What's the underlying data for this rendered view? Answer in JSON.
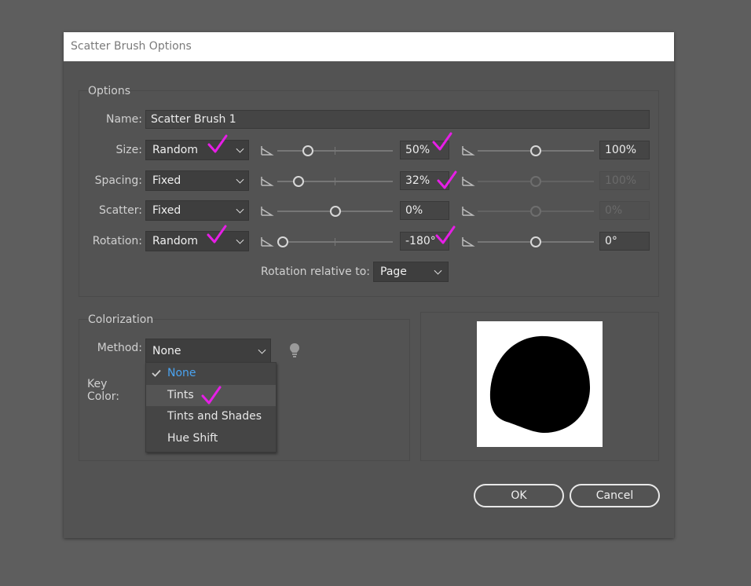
{
  "window": {
    "title": "Scatter Brush Options"
  },
  "options": {
    "group_label": "Options",
    "name_label": "Name:",
    "name_value": "Scatter Brush 1",
    "rows": [
      {
        "label": "Size:",
        "method": "Random",
        "min": "50%",
        "max": "100%",
        "max_enabled": true,
        "min_knob": 0.24,
        "max_knob": 0.5
      },
      {
        "label": "Spacing:",
        "method": "Fixed",
        "min": "32%",
        "max": "100%",
        "max_enabled": false,
        "min_knob": 0.15,
        "max_knob": 0.5
      },
      {
        "label": "Scatter:",
        "method": "Fixed",
        "min": "0%",
        "max": "0%",
        "max_enabled": false,
        "min_knob": 0.5,
        "max_knob": 0.5
      },
      {
        "label": "Rotation:",
        "method": "Random",
        "min": "-180°",
        "max": "0°",
        "max_enabled": true,
        "min_knob": 0.0,
        "max_knob": 0.5
      }
    ],
    "rotation_relative_label": "Rotation relative to:",
    "rotation_relative_value": "Page"
  },
  "colorization": {
    "group_label": "Colorization",
    "method_label": "Method:",
    "method_value": "None",
    "key_color_label": "Key Color:",
    "menu_items": [
      "None",
      "Tints",
      "Tints and Shades",
      "Hue Shift"
    ],
    "menu_selected": "None",
    "menu_highlighted": "Tints",
    "tip_icon": "lightbulb-icon"
  },
  "buttons": {
    "ok": "OK",
    "cancel": "Cancel"
  },
  "colors": {
    "annotation_check": "#e61ee6",
    "selected_item": "#4aa3f0",
    "dialog_bg": "#535353"
  }
}
